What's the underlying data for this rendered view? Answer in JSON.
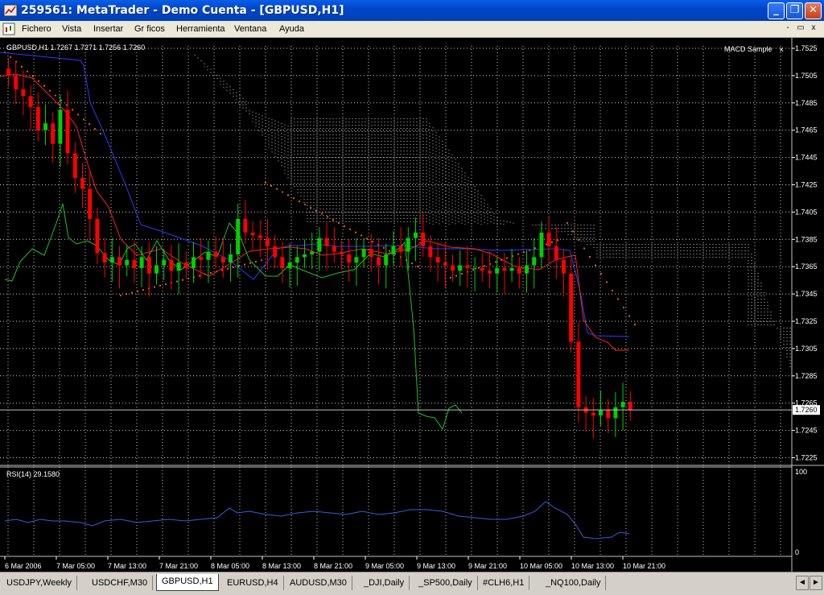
{
  "window": {
    "title": "259561: MetaTrader - Demo Cuenta - [GBPUSD,H1]",
    "minimize": "_",
    "restore": "❐",
    "close": "✕"
  },
  "menu": {
    "items": [
      "Fichero",
      "Vista",
      "Insertar",
      "Gr ficos",
      "Herramienta",
      "Ventana",
      "Ayuda"
    ],
    "mdi_minimize": "-",
    "mdi_restore": "▭",
    "mdi_close": "x"
  },
  "chart": {
    "header": "GBPUSD,H1  1.7267 1.7271 1.7256 1.7260",
    "expert": "MACD Sample",
    "expert_icon": "close-x-icon",
    "price_ticks": [
      "1.7525",
      "1.7505",
      "1.7485",
      "1.7465",
      "1.7445",
      "1.7425",
      "1.7405",
      "1.7385",
      "1.7365",
      "1.7345",
      "1.7325",
      "1.7305",
      "1.7285",
      "1.7265",
      "1.7245",
      "1.7225"
    ],
    "current_price": "1.7260",
    "time_ticks": [
      "6 Mar 2006",
      "7 Mar 05:00",
      "7 Mar 13:00",
      "7 Mar 21:00",
      "8 Mar 05:00",
      "8 Mar 13:00",
      "8 Mar 21:00",
      "9 Mar 05:00",
      "9 Mar 13:00",
      "9 Mar 21:00",
      "10 Mar 05:00",
      "10 Mar 13:00",
      "10 Mar 21:00"
    ],
    "rsi_label": "RSI(14) 29.1580",
    "rsi_ticks": [
      "100",
      "0"
    ],
    "colors": {
      "background": "#000000",
      "grid": "#c8c8c8",
      "bull": "#00d000",
      "bear": "#ff0000",
      "kijun": "#2040ff",
      "tenkan": "#ff2020",
      "chikou": "#20c020",
      "cloud": "#e8e8e8",
      "sar": "#ff5a20",
      "rsi": "#3060e0",
      "text": "#ffffff"
    }
  },
  "tabs": [
    "USDJPY,Weekly",
    "USDCHF,M30",
    "GBPUSD,H1",
    "EURUSD,H4",
    "AUDUSD,M30",
    "_DJI,Daily",
    "_SP500,Daily",
    "#CLH6,H1",
    "_NQ100,Daily"
  ],
  "active_tab": "GBPUSD,H1",
  "tab_arrows": [
    "◄",
    "►"
  ]
}
